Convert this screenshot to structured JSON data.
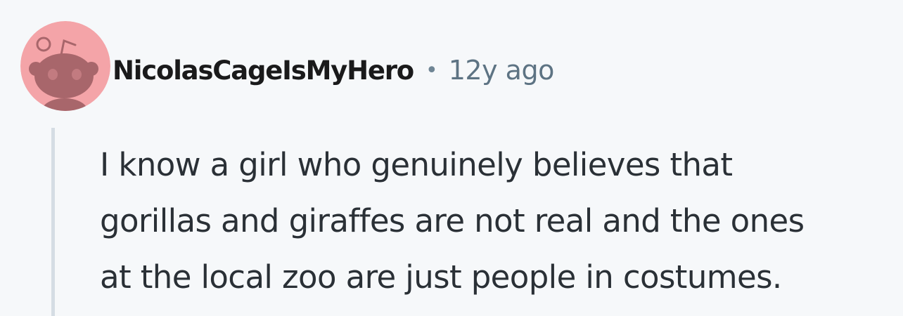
{
  "comment": {
    "author": "NicolasCageIsMyHero",
    "separator": "•",
    "age": "12y ago",
    "body_lines": [
      "I know a girl who genuinely believes that",
      "gorillas and giraffes are not real and the ones",
      "at the local zoo are just people in costumes."
    ],
    "avatar_icon": "snoo-avatar-icon"
  },
  "colors": {
    "background": "#f6f8fa",
    "avatar_bg": "#f4a4a8",
    "avatar_figure": "#a8666b",
    "username": "#1a1a1b",
    "meta": "#5d7383",
    "body_text": "#2a3036",
    "thread_line": "#d5dde4"
  }
}
